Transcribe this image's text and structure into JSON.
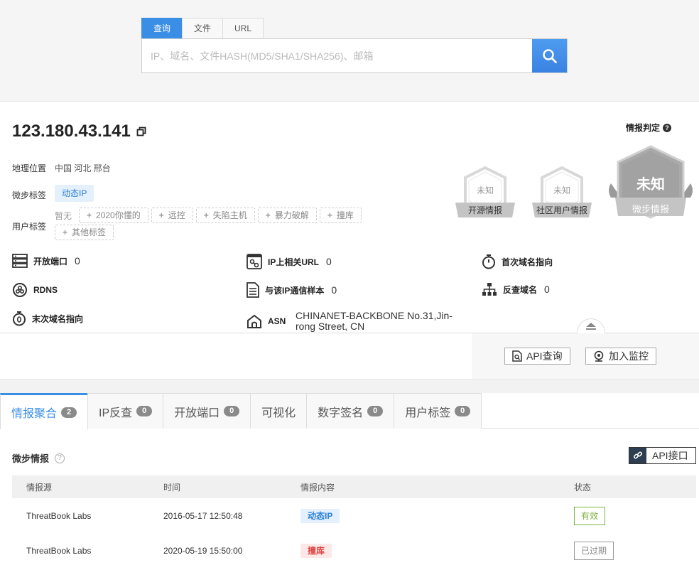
{
  "search": {
    "tabs": [
      "查询",
      "文件",
      "URL"
    ],
    "placeholder": "IP、域名、文件HASH(MD5/SHA1/SHA256)、邮箱"
  },
  "ip": {
    "address": "123.180.43.141",
    "geo_label": "地理位置",
    "geo_value": "中国 河北 邢台",
    "tb_label": "微步标签",
    "tb_tag": "动态IP",
    "user_label": "用户标签",
    "user_none": "暂无",
    "user_tags": [
      "2020你懂的",
      "远控",
      "失陷主机",
      "暴力破解",
      "撞库",
      "其他标签"
    ]
  },
  "verdict": {
    "label": "情报判定",
    "badges": [
      {
        "status": "未知",
        "name": "开源情报"
      },
      {
        "status": "未知",
        "name": "社区用户情报"
      },
      {
        "status": "未知",
        "name": "微步情报"
      }
    ]
  },
  "stats": {
    "open_ports_label": "开放端口",
    "open_ports": "0",
    "ip_urls_label": "IP上相关URL",
    "ip_urls": "0",
    "first_domain_label": "首次域名指向",
    "rdns_label": "RDNS",
    "samples_label": "与该IP通信样本",
    "samples": "0",
    "reverse_label": "反查域名",
    "reverse": "0",
    "last_domain_label": "末次域名指向",
    "asn_label": "ASN",
    "asn_value": "CHINANET-BACKBONE No.31,Jin-rong Street, CN"
  },
  "actions": {
    "api_query": "API查询",
    "monitor": "加入监控"
  },
  "bottom_tabs": [
    {
      "label": "情报聚合",
      "count": "2"
    },
    {
      "label": "IP反查",
      "count": "0"
    },
    {
      "label": "开放端口",
      "count": "0"
    },
    {
      "label": "可视化",
      "count": ""
    },
    {
      "label": "数字签名",
      "count": "0"
    },
    {
      "label": "用户标签",
      "count": "0"
    }
  ],
  "intel": {
    "title": "微步情报",
    "api_label": "API接口",
    "columns": [
      "情报源",
      "时间",
      "情报内容",
      "状态"
    ],
    "rows": [
      {
        "source": "ThreatBook Labs",
        "time": "2016-05-17 12:50:48",
        "content": "动态IP",
        "status": "有效"
      },
      {
        "source": "ThreatBook Labs",
        "time": "2020-05-19 15:50:00",
        "content": "撞库",
        "status": "已过期"
      }
    ]
  },
  "colors": {
    "accent": "#3a8ee6",
    "valid": "#7cb342",
    "danger": "#e04040"
  }
}
